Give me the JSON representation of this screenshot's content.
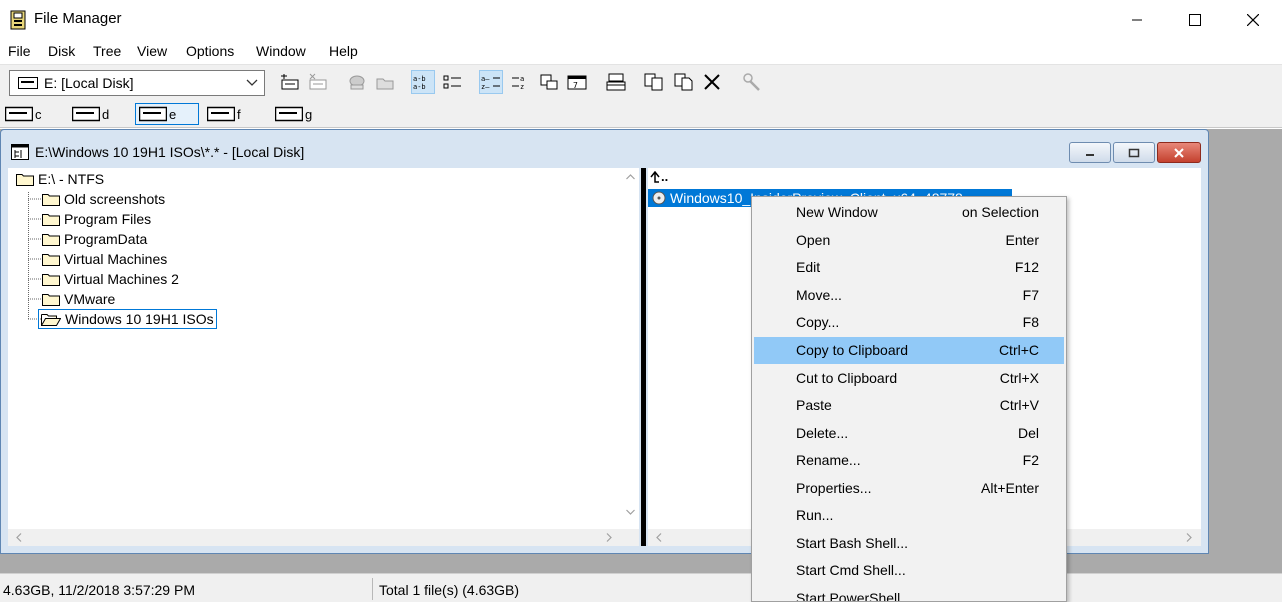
{
  "window": {
    "title": "File Manager"
  },
  "menubar": [
    "File",
    "Disk",
    "Tree",
    "View",
    "Options",
    "Window",
    "Help"
  ],
  "toolbar": {
    "drive_select": "E: [Local Disk]"
  },
  "drives": [
    "c",
    "d",
    "e",
    "f",
    "g"
  ],
  "child_window": {
    "title": "E:\\Windows 10 19H1 ISOs\\*.* - [Local Disk]"
  },
  "tree": {
    "root": "E:\\ - NTFS",
    "folders": [
      "Old screenshots",
      "Program Files",
      "ProgramData",
      "Virtual Machines",
      "Virtual Machines 2",
      "VMware",
      "Windows 10 19H1 ISOs"
    ],
    "selected": "Windows 10 19H1 ISOs"
  },
  "files": {
    "parent": "..",
    "selected_file": "Windows10_InsiderPreview_Client_x64",
    "selected_size": "48778..."
  },
  "context_menu": [
    {
      "label": "New Window",
      "key": "on Selection"
    },
    {
      "label": "Open",
      "key": "Enter"
    },
    {
      "label": "Edit",
      "key": "F12"
    },
    {
      "label": "Move...",
      "key": "F7"
    },
    {
      "label": "Copy...",
      "key": "F8"
    },
    {
      "label": "Copy to Clipboard",
      "key": "Ctrl+C"
    },
    {
      "label": "Cut to Clipboard",
      "key": "Ctrl+X"
    },
    {
      "label": "Paste",
      "key": "Ctrl+V"
    },
    {
      "label": "Delete...",
      "key": "Del"
    },
    {
      "label": "Rename...",
      "key": "F2"
    },
    {
      "label": "Properties...",
      "key": "Alt+Enter"
    },
    {
      "label": "Run...",
      "key": ""
    },
    {
      "label": "Start Bash Shell...",
      "key": ""
    },
    {
      "label": "Start Cmd Shell...",
      "key": ""
    },
    {
      "label": "Start PowerShell...",
      "key": ""
    }
  ],
  "context_menu_highlighted": "Copy to Clipboard",
  "statusbar": {
    "left": "4.63GB, 11/2/2018 3:57:29 PM",
    "right": "Total 1 file(s) (4.63GB)"
  },
  "colors": {
    "selection": "#0078d7",
    "menu_highlight": "#91c9f7",
    "mdi_background": "#aaaaaa"
  }
}
